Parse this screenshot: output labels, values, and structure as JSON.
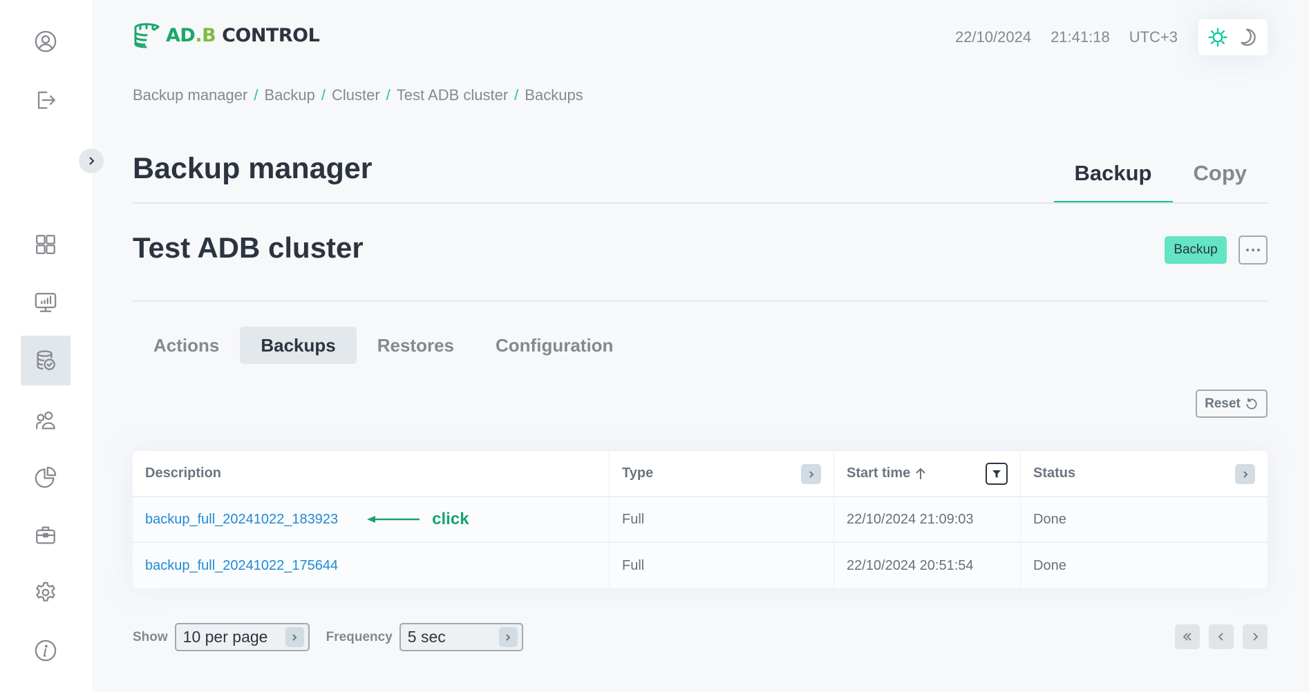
{
  "sidebar": {
    "top_icons": [
      {
        "icon": "user-profile-icon",
        "label": "Profile"
      },
      {
        "icon": "logout-icon",
        "label": "Log out"
      }
    ],
    "expand_icon": "chevron-right-icon",
    "nav_items": [
      {
        "icon": "dashboard-grid-icon",
        "label": "Dashboard",
        "active": false
      },
      {
        "icon": "monitoring-chart-icon",
        "label": "Monitoring",
        "active": false
      },
      {
        "icon": "backup-database-icon",
        "label": "Backup manager",
        "active": true
      },
      {
        "icon": "users-icon",
        "label": "Users",
        "active": false
      },
      {
        "icon": "pie-chart-icon",
        "label": "Reports",
        "active": false
      },
      {
        "icon": "briefcase-icon",
        "label": "Jobs",
        "active": false
      },
      {
        "icon": "settings-gear-icon",
        "label": "Settings",
        "active": false
      },
      {
        "icon": "info-icon",
        "label": "Info",
        "active": false
      }
    ]
  },
  "header": {
    "logo": {
      "part1": "AD",
      "part2": ".B",
      "part3": "CONTROL"
    },
    "date": "22/10/2024",
    "time": "21:41:18",
    "timezone": "UTC+3",
    "theme": {
      "light_icon": "sun-icon",
      "dark_icon": "moon-icon",
      "active": "light"
    }
  },
  "breadcrumb": [
    "Backup manager",
    "Backup",
    "Cluster",
    "Test ADB cluster",
    "Backups"
  ],
  "page": {
    "title": "Backup manager",
    "tabs": [
      {
        "label": "Backup",
        "active": true
      },
      {
        "label": "Copy",
        "active": false
      }
    ]
  },
  "cluster": {
    "name": "Test ADB cluster",
    "backup_button": "Backup",
    "more_button_icon": "ellipsis-icon"
  },
  "sub_tabs": [
    {
      "label": "Actions",
      "active": false
    },
    {
      "label": "Backups",
      "active": true
    },
    {
      "label": "Restores",
      "active": false
    },
    {
      "label": "Configuration",
      "active": false
    }
  ],
  "reset_button": "Reset",
  "table": {
    "columns": [
      {
        "label": "Description"
      },
      {
        "label": "Type",
        "control": "expand"
      },
      {
        "label": "Start time",
        "sort": "ascending",
        "control": "filter"
      },
      {
        "label": "Status",
        "control": "expand"
      }
    ],
    "rows": [
      {
        "description": "backup_full_20241022_183923",
        "type": "Full",
        "start_time": "22/10/2024 21:09:03",
        "status": "Done"
      },
      {
        "description": "backup_full_20241022_175644",
        "type": "Full",
        "start_time": "22/10/2024 20:51:54",
        "status": "Done"
      }
    ],
    "annotation": {
      "text": "click",
      "color": "#17a36f"
    }
  },
  "footer": {
    "show_label": "Show",
    "per_page": "10 per page",
    "frequency_label": "Frequency",
    "frequency": "5 sec"
  },
  "colors": {
    "accent": "#00c895",
    "link": "#1d8ad6",
    "backup_button": "#63e4c5",
    "logo_green": "#1aa86a",
    "logo_lime": "#7cbd3b"
  }
}
